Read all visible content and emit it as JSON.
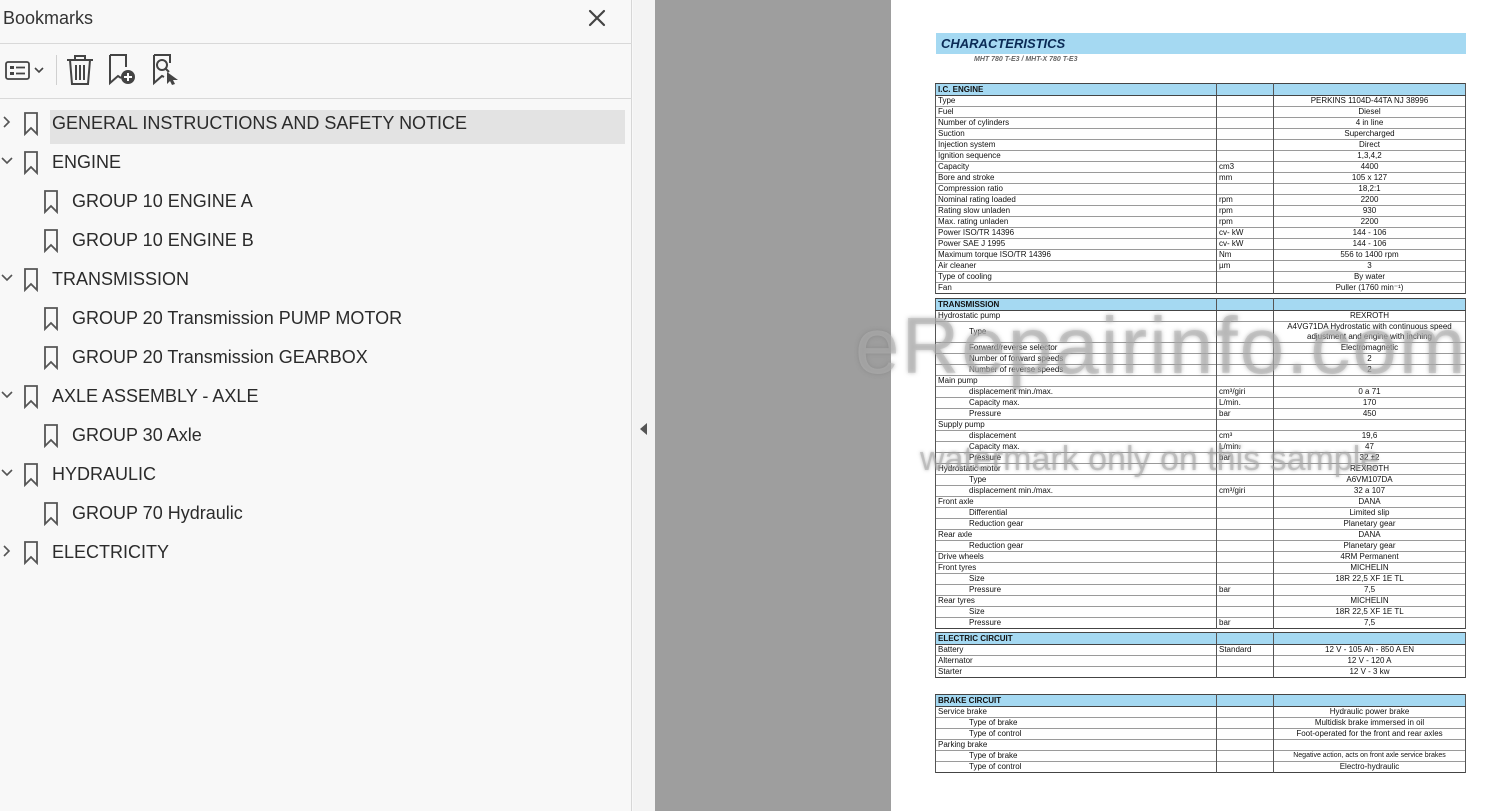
{
  "panel": {
    "title": "Bookmarks",
    "close_icon": "close-icon",
    "toolbar": [
      {
        "name": "options-menu",
        "icon": "list-options-icon"
      },
      {
        "name": "delete-bookmark",
        "icon": "trash-icon"
      },
      {
        "name": "new-bookmark",
        "icon": "add-bookmark-icon"
      },
      {
        "name": "find-bookmark",
        "icon": "search-bookmark-icon"
      }
    ]
  },
  "bookmarks": [
    {
      "label": "GENERAL INSTRUCTIONS AND SAFETY NOTICE",
      "level": 0,
      "state": "collapsed",
      "selected": true
    },
    {
      "label": "ENGINE",
      "level": 0,
      "state": "expanded"
    },
    {
      "label": "GROUP 10 ENGINE  A",
      "level": 1
    },
    {
      "label": "GROUP 10 ENGINE B",
      "level": 1
    },
    {
      "label": "TRANSMISSION",
      "level": 0,
      "state": "expanded"
    },
    {
      "label": "GROUP 20 Transmission PUMP MOTOR",
      "level": 1
    },
    {
      "label": "GROUP 20 Transmission GEARBOX",
      "level": 1
    },
    {
      "label": "AXLE ASSEMBLY - AXLE",
      "level": 0,
      "state": "expanded"
    },
    {
      "label": "GROUP 30 Axle",
      "level": 1
    },
    {
      "label": "HYDRAULIC",
      "level": 0,
      "state": "expanded"
    },
    {
      "label": "GROUP 70 Hydraulic",
      "level": 1
    },
    {
      "label": "ELECTRICITY",
      "level": 0,
      "state": "collapsed"
    }
  ],
  "document": {
    "title": "CHARACTERISTICS",
    "subtitle": "MHT 780 T-E3  /  MHT-X 780 T-E3",
    "watermark": "eRepairinfo.com",
    "watermark_note": "watermark only on this sample",
    "sections": [
      {
        "heading": "I.C. ENGINE",
        "rows": [
          [
            "Type",
            "",
            "PERKINS 1104D-44TA NJ 38996"
          ],
          [
            "Fuel",
            "",
            "Diesel"
          ],
          [
            "Number of cylinders",
            "",
            "4 in line"
          ],
          [
            "Suction",
            "",
            "Supercharged"
          ],
          [
            "Injection system",
            "",
            "Direct"
          ],
          [
            "Ignition sequence",
            "",
            "1,3,4,2"
          ],
          [
            "Capacity",
            "cm3",
            "4400"
          ],
          [
            "Bore and stroke",
            "mm",
            "105 x 127"
          ],
          [
            "Compression ratio",
            "",
            "18,2:1"
          ],
          [
            "Nominal rating loaded",
            "rpm",
            "2200"
          ],
          [
            "Rating slow unladen",
            "rpm",
            "930"
          ],
          [
            "Max. rating unladen",
            "rpm",
            "2200"
          ],
          [
            "Power ISO/TR 14396",
            "cv- kW",
            "144 - 106"
          ],
          [
            "Power SAE J 1995",
            "cv- kW",
            "144 - 106"
          ],
          [
            "Maximum torque ISO/TR 14396",
            "Nm",
            "556 to 1400 rpm"
          ],
          [
            "Air cleaner",
            "µm",
            "3"
          ],
          [
            "Type of cooling",
            "",
            "By water"
          ],
          [
            "Fan",
            "",
            "Puller (1760 min⁻¹)"
          ]
        ]
      },
      {
        "heading": "TRANSMISSION",
        "rows": [
          [
            "Hydrostatic pump",
            "",
            "REXROTH"
          ],
          [
            ">Type",
            "",
            "A4VG71DA  Hydrostatic with continuous speed adjustment and engine with inching"
          ],
          [
            ">Forward/reverse selector",
            "",
            "Electromagnetic"
          ],
          [
            ">Number of forward speeds",
            "",
            "2"
          ],
          [
            ">Number of reverse speeds",
            "",
            "2"
          ],
          [
            "Main pump",
            "",
            ""
          ],
          [
            ">displacement min./max.",
            "cm³/giri",
            "0 a 71"
          ],
          [
            ">Capacity max.",
            "L/min.",
            "170"
          ],
          [
            ">Pressure",
            "bar",
            "450"
          ],
          [
            "Supply pump",
            "",
            ""
          ],
          [
            ">displacement",
            "cm³",
            "19,6"
          ],
          [
            ">Capacity max.",
            "L/min.",
            "47"
          ],
          [
            ">Pressure",
            "bar",
            "32 ±2"
          ],
          [
            "Hydrostatic motor",
            "",
            "REXROTH"
          ],
          [
            ">Type",
            "",
            "A6VM107DA"
          ],
          [
            ">displacement min./max.",
            "cm³/giri",
            "32 a 107"
          ],
          [
            "Front axle",
            "",
            "DANA"
          ],
          [
            ">Differential",
            "",
            "Limited slip"
          ],
          [
            ">Reduction gear",
            "",
            "Planetary gear"
          ],
          [
            "Rear axle",
            "",
            "DANA"
          ],
          [
            ">Reduction gear",
            "",
            "Planetary gear"
          ],
          [
            "Drive wheels",
            "",
            "4RM Permanent"
          ],
          [
            "Front tyres",
            "",
            "MICHELIN"
          ],
          [
            ">Size",
            "",
            "18R 22,5 XF 1E TL"
          ],
          [
            ">Pressure",
            "bar",
            "7,5"
          ],
          [
            "Rear tyres",
            "",
            "MICHELIN"
          ],
          [
            ">Size",
            "",
            "18R 22,5 XF 1E TL"
          ],
          [
            ">Pressure",
            "bar",
            "7,5"
          ]
        ]
      },
      {
        "heading": "ELECTRIC CIRCUIT",
        "rows": [
          [
            "Battery",
            "Standard",
            "12 V - 105 Ah - 850 A EN"
          ],
          [
            "Alternator",
            "",
            "12 V - 120 A"
          ],
          [
            "Starter",
            "",
            "12 V - 3 kw"
          ]
        ]
      },
      {
        "heading": "BRAKE CIRCUIT",
        "rows": [
          [
            "Service brake",
            "",
            "Hydraulic power brake"
          ],
          [
            ">Type of brake",
            "",
            "Multidisk brake immersed in oil"
          ],
          [
            ">Type of control",
            "",
            "Foot-operated for the front and rear axles"
          ],
          [
            "Parking brake",
            "",
            ""
          ],
          [
            ">Type of brake",
            "",
            "Negative action, acts on front axle service brakes"
          ],
          [
            ">Type of control",
            "",
            "Electro-hydraulic"
          ]
        ]
      }
    ]
  }
}
